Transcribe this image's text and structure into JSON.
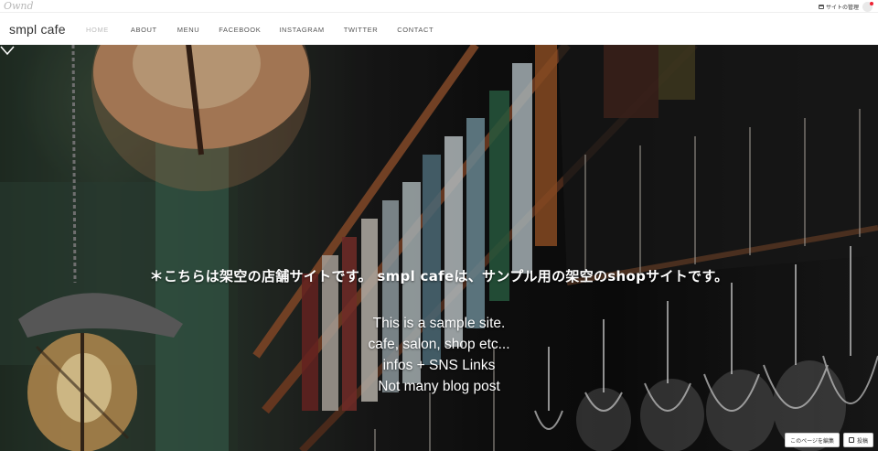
{
  "adminbar": {
    "brand": "Ownd",
    "manage_label": "サイトの管理"
  },
  "header": {
    "site_title": "smpl cafe",
    "nav": [
      {
        "label": "HOME",
        "active": true
      },
      {
        "label": "ABOUT",
        "active": false
      },
      {
        "label": "MENU",
        "active": false
      },
      {
        "label": "FACEBOOK",
        "active": false
      },
      {
        "label": "INSTAGRAM",
        "active": false
      },
      {
        "label": "TWITTER",
        "active": false
      },
      {
        "label": "CONTACT",
        "active": false
      }
    ]
  },
  "hero": {
    "headline_jp": "＊こちらは架空の店舗サイトです。 smpl cafeは、サンプル用の架空のshopサイトです。",
    "lines": [
      "This is a sample site.",
      "cafe, salon, shop etc...",
      "infos + SNS Links",
      "Not many blog post"
    ],
    "scroll_icon": "chevron-down-icon"
  },
  "edit_buttons": {
    "edit_page": "このページを編集",
    "post": "投稿"
  }
}
